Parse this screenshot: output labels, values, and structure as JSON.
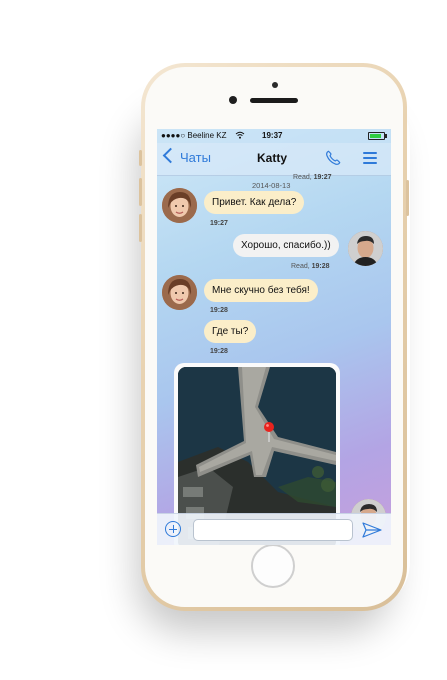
{
  "status_bar": {
    "carrier": "●●●●○ Beeline KZ",
    "time": "19:37"
  },
  "nav": {
    "back_label": "Чаты",
    "title": "Katty"
  },
  "chat": {
    "top_read_prefix": "Read,",
    "top_read_time": "19:27",
    "date": "2014-08-13",
    "messages": [
      {
        "direction": "in",
        "text": "Привет. Как дела?",
        "time": "19:27"
      },
      {
        "direction": "out",
        "text": "Хорошо, спасибо.))",
        "status": "Read,",
        "time": "19:28"
      },
      {
        "direction": "in",
        "text": "Мне скучно без тебя!",
        "time": "19:28"
      },
      {
        "direction": "in",
        "text": "Где ты?",
        "time": "19:28"
      },
      {
        "direction": "in",
        "type": "location-map"
      }
    ]
  },
  "input": {
    "placeholder": ""
  },
  "colors": {
    "accent": "#2f7ad9",
    "incoming_bubble": "#fbeec9",
    "outgoing_bubble": "#f2f2f2",
    "map_pin": "#e8231e"
  },
  "icons": [
    "signal-dots-icon",
    "wifi-icon",
    "battery-icon",
    "back-chevron-icon",
    "phone-call-icon",
    "menu-icon",
    "location-pin-icon",
    "add-attachment-icon",
    "send-icon"
  ]
}
